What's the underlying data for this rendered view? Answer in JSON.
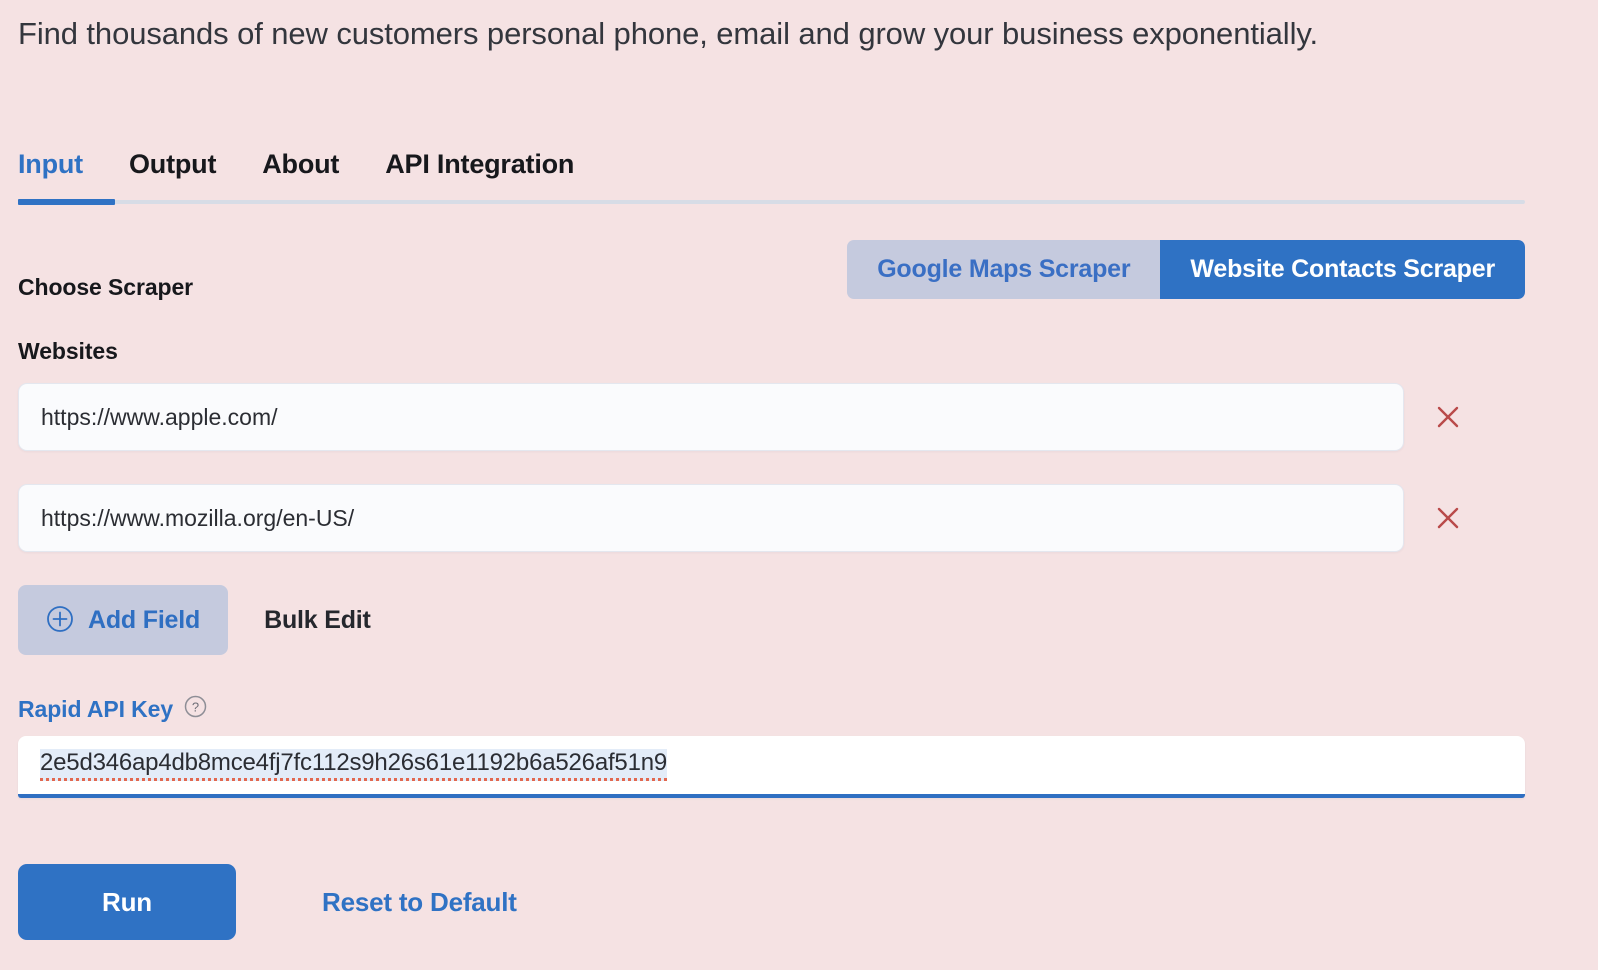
{
  "heading": "Find thousands of new customers personal phone, email and grow your business exponentially.",
  "tabs": [
    {
      "label": "Input",
      "active": true
    },
    {
      "label": "Output",
      "active": false
    },
    {
      "label": "About",
      "active": false
    },
    {
      "label": "API Integration",
      "active": false
    }
  ],
  "choose_scraper": {
    "label": "Choose Scraper",
    "options": [
      {
        "label": "Google Maps Scraper",
        "selected": false
      },
      {
        "label": "Website Contacts Scraper",
        "selected": true
      }
    ]
  },
  "websites": {
    "label": "Websites",
    "values": [
      "https://www.apple.com/",
      "https://www.mozilla.org/en-US/"
    ],
    "remove_icon": "close-x-icon"
  },
  "actions": {
    "add_field_label": "Add Field",
    "add_field_icon": "plus-circle-icon",
    "bulk_edit_label": "Bulk Edit"
  },
  "api_key": {
    "label": "Rapid API Key",
    "help_icon": "question-circle-icon",
    "value": "2e5d346ap4db8mce4fj7fc112s9h26s61e1192b6a526af51n9"
  },
  "footer": {
    "run_label": "Run",
    "reset_label": "Reset to Default"
  },
  "colors": {
    "background": "#f5e2e3",
    "accent_blue": "#2f72c4",
    "toggle_inactive": "#c5cade",
    "remove_red": "#b94a4a",
    "spellcheck_red": "#e2684f",
    "text_dark": "#17181c"
  }
}
